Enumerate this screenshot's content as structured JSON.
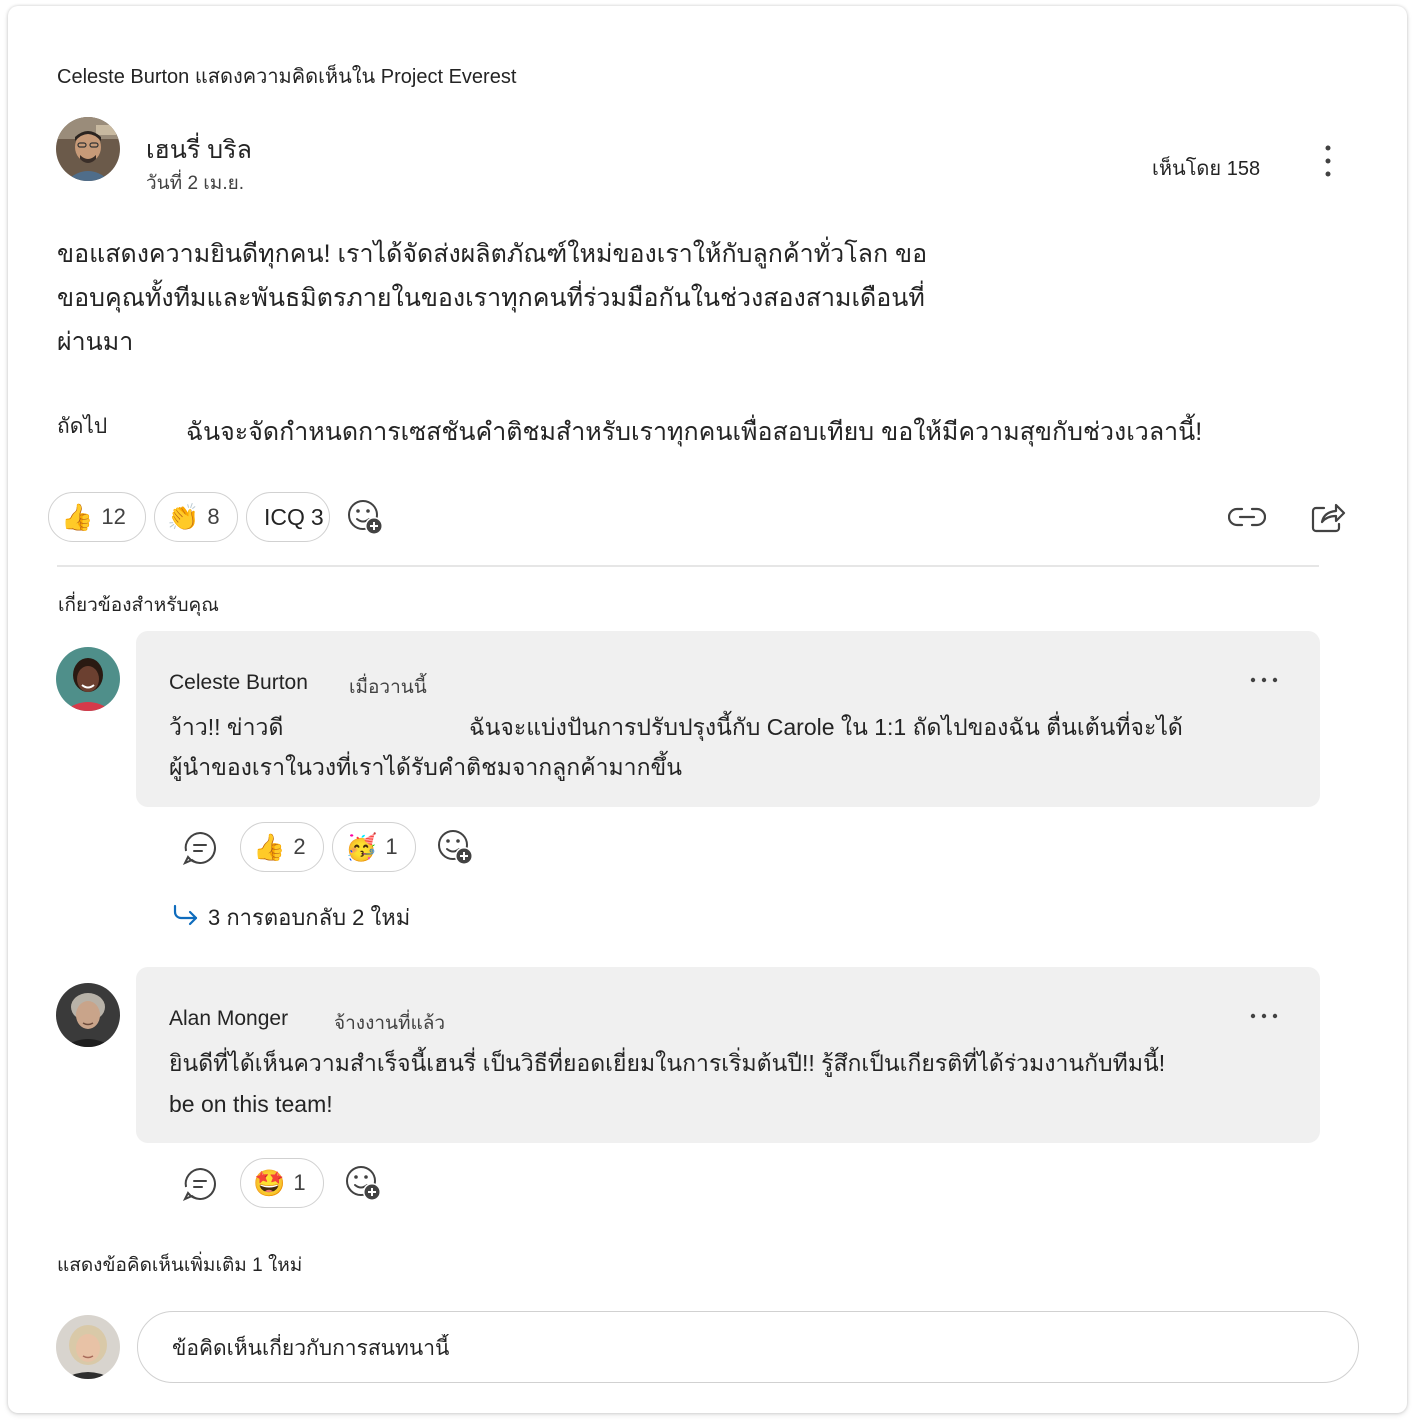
{
  "post": {
    "context_line": "Celeste Burton แสดงความคิดเห็นใน Project Everest",
    "author_name": "เฮนรี่ บริล",
    "date": "วันที่ 2 เม.ย.",
    "seen_by": "เห็นโดย 158",
    "body": "ขอแสดงความยินดีทุกคน! เราได้จัดส่งผลิตภัณฑ์ใหม่ของเราให้กับลูกค้าทั่วโลก ขอขอบคุณทั้งทีมและพันธมิตรภายในของเราทุกคนที่ร่วมมือกันในช่วงสองสามเดือนที่ผ่านมา",
    "next_label": "ถัดไป",
    "next_text": "ฉันจะจัดกำหนดการเซสชันคำติชมสำหรับเราทุกคนเพื่อสอบเทียบ ขอให้มีความสุขกับช่วงเวลานี้!",
    "reactions": [
      {
        "emoji": "👍",
        "count": "12",
        "icon": "thumbs-up-icon"
      },
      {
        "emoji": "👏",
        "count": "8",
        "icon": "clapping-hands-icon"
      },
      {
        "emoji": "ICQ",
        "count": "3",
        "icon": "icq-icon"
      }
    ],
    "add_reaction_icon": "add-reaction-icon",
    "link_icon": "link-icon",
    "share_icon": "share-icon"
  },
  "relevant_label": "เกี่ยวข้องสำหรับคุณ",
  "comments": [
    {
      "name": "Celeste Burton",
      "time": "เมื่อวานนี้",
      "line1_a": "ว้าว!! ข่าวดี",
      "line1_b": "ฉันจะแบ่งปันการปรับปรุงนี้กับ Carole ใน 1:1 ถัดไปของฉัน ตื่นเต้นที่จะได้",
      "line2": "ผู้นำของเราในวงที่เราได้รับคำติชมจากลูกค้ามากขึ้น",
      "reactions": [
        {
          "emoji": "👍",
          "count": "2",
          "icon": "thumbs-up-icon"
        },
        {
          "emoji": "🥳",
          "count": "1",
          "icon": "party-face-icon"
        }
      ],
      "replies": "3 การตอบกลับ 2 ใหม่"
    },
    {
      "name": "Alan Monger",
      "time": "จ้างงานที่แล้ว",
      "line1": "ยินดีที่ได้เห็นความสำเร็จนี้เฮนรี่ เป็นวิธีที่ยอดเยี่ยมในการเริ่มต้นปี!! รู้สึกเป็นเกียรติที่ได้ร่วมงานกับทีมนี้!",
      "line2": "be on this team!",
      "reactions": [
        {
          "emoji": "🤩",
          "count": "1",
          "icon": "star-struck-icon"
        }
      ]
    }
  ],
  "more_comments": "แสดงข้อคิดเห็นเพิ่มเติม 1 ใหม่",
  "composer": {
    "placeholder": "ข้อคิดเห็นเกี่ยวกับการสนทนานี้"
  },
  "colors": {
    "bubble": "#f0f0f0",
    "accent_blue": "#0f6cbd",
    "border": "#d1d1d1"
  }
}
